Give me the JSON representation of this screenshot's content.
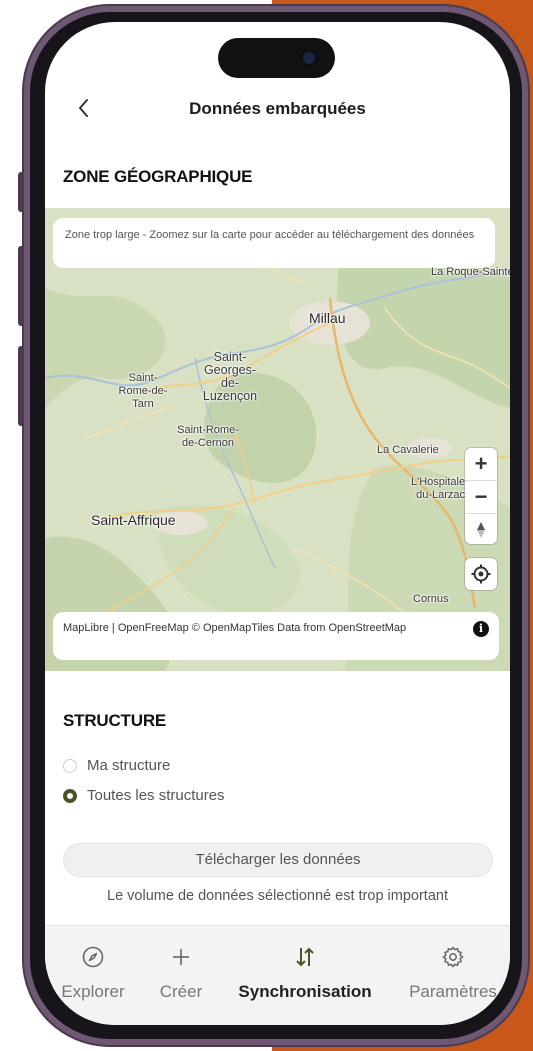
{
  "header": {
    "title": "Données embarquées"
  },
  "zone": {
    "section_title": "ZONE GÉOGRAPHIQUE",
    "banner": "Zone trop large - Zoomez sur la carte pour accéder au téléchargement des données",
    "attribution": "MapLibre | OpenFreeMap © OpenMapTiles Data from OpenStreetMap",
    "map_labels": [
      "La Roque-Sainte-Marguerite",
      "Millau",
      "Saint-Georges-de-Luzençon",
      "Saint-Rome-de-Tarn",
      "Saint-Rome-de-Cernon",
      "La Cavalerie",
      "L'Hospitalet-du-Larzac",
      "Saint-Affrique",
      "Cornus"
    ]
  },
  "structure": {
    "section_title": "STRUCTURE",
    "options": [
      {
        "label": "Ma structure",
        "selected": false
      },
      {
        "label": "Toutes les structures",
        "selected": true
      }
    ]
  },
  "download": {
    "button_label": "Télécharger les données",
    "warning": "Le volume de données sélectionné est trop important"
  },
  "tabs": [
    {
      "label": "Explorer",
      "icon": "compass-icon",
      "active": false
    },
    {
      "label": "Créer",
      "icon": "plus-icon",
      "active": false
    },
    {
      "label": "Synchronisation",
      "icon": "sync-arrows-icon",
      "active": true
    },
    {
      "label": "Paramètres",
      "icon": "gear-icon",
      "active": false
    }
  ],
  "colors": {
    "accent": "#4b5327",
    "frame": "#6e5873",
    "background_accent": "#c8581a"
  }
}
